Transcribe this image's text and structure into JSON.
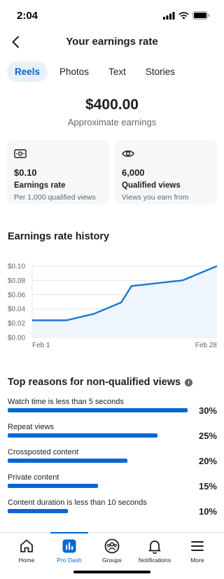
{
  "status_bar": {
    "time": "2:04"
  },
  "header": {
    "title": "Your earnings rate"
  },
  "tabs": [
    {
      "label": "Reels",
      "active": true
    },
    {
      "label": "Photos",
      "active": false
    },
    {
      "label": "Text",
      "active": false
    },
    {
      "label": "Stories",
      "active": false
    }
  ],
  "earnings": {
    "amount": "$400.00",
    "label": "Approximate earnings"
  },
  "cards": [
    {
      "icon": "money-icon",
      "value": "$0.10",
      "label": "Earnings rate",
      "description": "Per 1,000 qualified views"
    },
    {
      "icon": "eye-icon",
      "value": "6,000",
      "label": "Qualified views",
      "description": "Views you earn from"
    }
  ],
  "history": {
    "title": "Earnings rate history"
  },
  "chart_data": {
    "type": "area",
    "title": "Earnings rate history",
    "x_tick_labels": [
      "Feb 1",
      "Feb 28"
    ],
    "y_tick_labels": [
      "$0.00",
      "$0.02",
      "$0.04",
      "$0.06",
      "$0.08",
      "$0.10"
    ],
    "ylim": [
      0,
      0.1
    ],
    "x_range": [
      1,
      28
    ],
    "grid": true,
    "series": [
      {
        "points": [
          [
            1,
            0.024
          ],
          [
            6,
            0.024
          ],
          [
            10,
            0.033
          ],
          [
            14,
            0.049
          ],
          [
            15.5,
            0.072
          ],
          [
            23,
            0.08
          ],
          [
            28,
            0.1
          ]
        ]
      }
    ],
    "line_color": "#1877d6",
    "fill_color": "#eef5fc"
  },
  "reasons": {
    "title": "Top reasons for non-qualified views",
    "items": [
      {
        "label": "Watch time is less than 5 seconds",
        "percent": "30%",
        "value": 30
      },
      {
        "label": "Repeat views",
        "percent": "25%",
        "value": 25
      },
      {
        "label": "Crossposted content",
        "percent": "20%",
        "value": 20
      },
      {
        "label": "Private content",
        "percent": "15%",
        "value": 15
      },
      {
        "label": "Content duration is less than 10 seconds",
        "percent": "10%",
        "value": 10
      }
    ]
  },
  "nav": [
    {
      "label": "Home",
      "icon": "home-icon",
      "active": false
    },
    {
      "label": "Pro Dash",
      "icon": "pro-dash-icon",
      "active": true
    },
    {
      "label": "Groups",
      "icon": "groups-icon",
      "active": false
    },
    {
      "label": "Notifications",
      "icon": "bell-icon",
      "active": false
    },
    {
      "label": "More",
      "icon": "menu-icon",
      "active": false
    }
  ],
  "colors": {
    "accent": "#0866d6",
    "tab_active_bg": "#e7f1fb",
    "card_bg": "#f5f7f9"
  }
}
